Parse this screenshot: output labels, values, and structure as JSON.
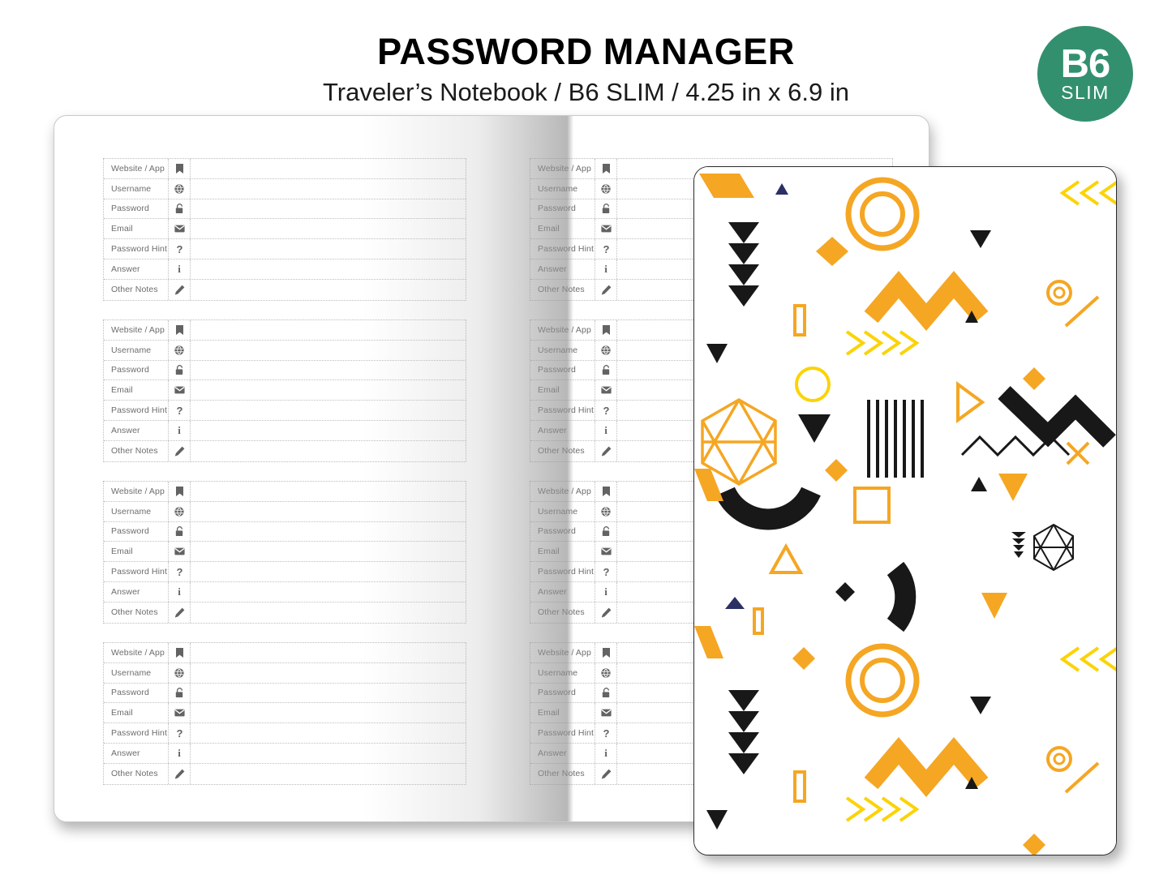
{
  "header": {
    "title": "PASSWORD MANAGER",
    "subtitle": "Traveler’s Notebook / B6 SLIM / 4.25 in x 6.9 in"
  },
  "size_badge": {
    "main": "B6",
    "sub": "SLIM",
    "color": "#33906f",
    "text_color": "#ffffff"
  },
  "form": {
    "rows": [
      {
        "label": "Website / App",
        "icon": "bookmark-icon",
        "value": ""
      },
      {
        "label": "Username",
        "icon": "globe-icon",
        "value": ""
      },
      {
        "label": "Password",
        "icon": "lock-icon",
        "value": ""
      },
      {
        "label": "Email",
        "icon": "envelope-icon",
        "value": ""
      },
      {
        "label": "Password Hint",
        "icon": "question-mark-icon",
        "value": ""
      },
      {
        "label": "Answer",
        "icon": "info-icon",
        "value": ""
      },
      {
        "label": "Other Notes",
        "icon": "pencil-icon",
        "value": ""
      }
    ],
    "blocks_per_page": 4,
    "label_color": "#6d6d6d",
    "rule_color": "#bfbfbf"
  },
  "notebook": {
    "page_background": "#ffffff",
    "border_color": "#c9c9c9",
    "left_page_label": "left-page",
    "right_page_label": "right-page"
  },
  "cover": {
    "background": "#ffffff",
    "border_color": "#2b2b2b",
    "palette": {
      "amber": "#F5A623",
      "yellow": "#FBD307",
      "black": "#181818",
      "navy": "#2b2f63"
    },
    "shapes": [
      "yellow-parallelogram",
      "navy-triangle-up",
      "black-triangle-stack",
      "amber-ring",
      "amber-diamond",
      "amber-zigzag-thick",
      "yellow-chevrons-right",
      "yellow-chevrons-left",
      "black-triangle-down",
      "amber-rect-outline",
      "amber-hexagon-outline",
      "black-vertical-bars",
      "black-arc",
      "amber-square-outline",
      "amber-small-circle",
      "black-zigzag-thin",
      "yellow-x",
      "black-hexagon-outline",
      "amber-triangle-down",
      "amber-triangle-outline",
      "black-small-diamond",
      "yellow-diagonal-line",
      "black-zigzag-thick",
      "amber-diamond-outline",
      "black-triangle-up",
      "black-arrow-down"
    ]
  }
}
